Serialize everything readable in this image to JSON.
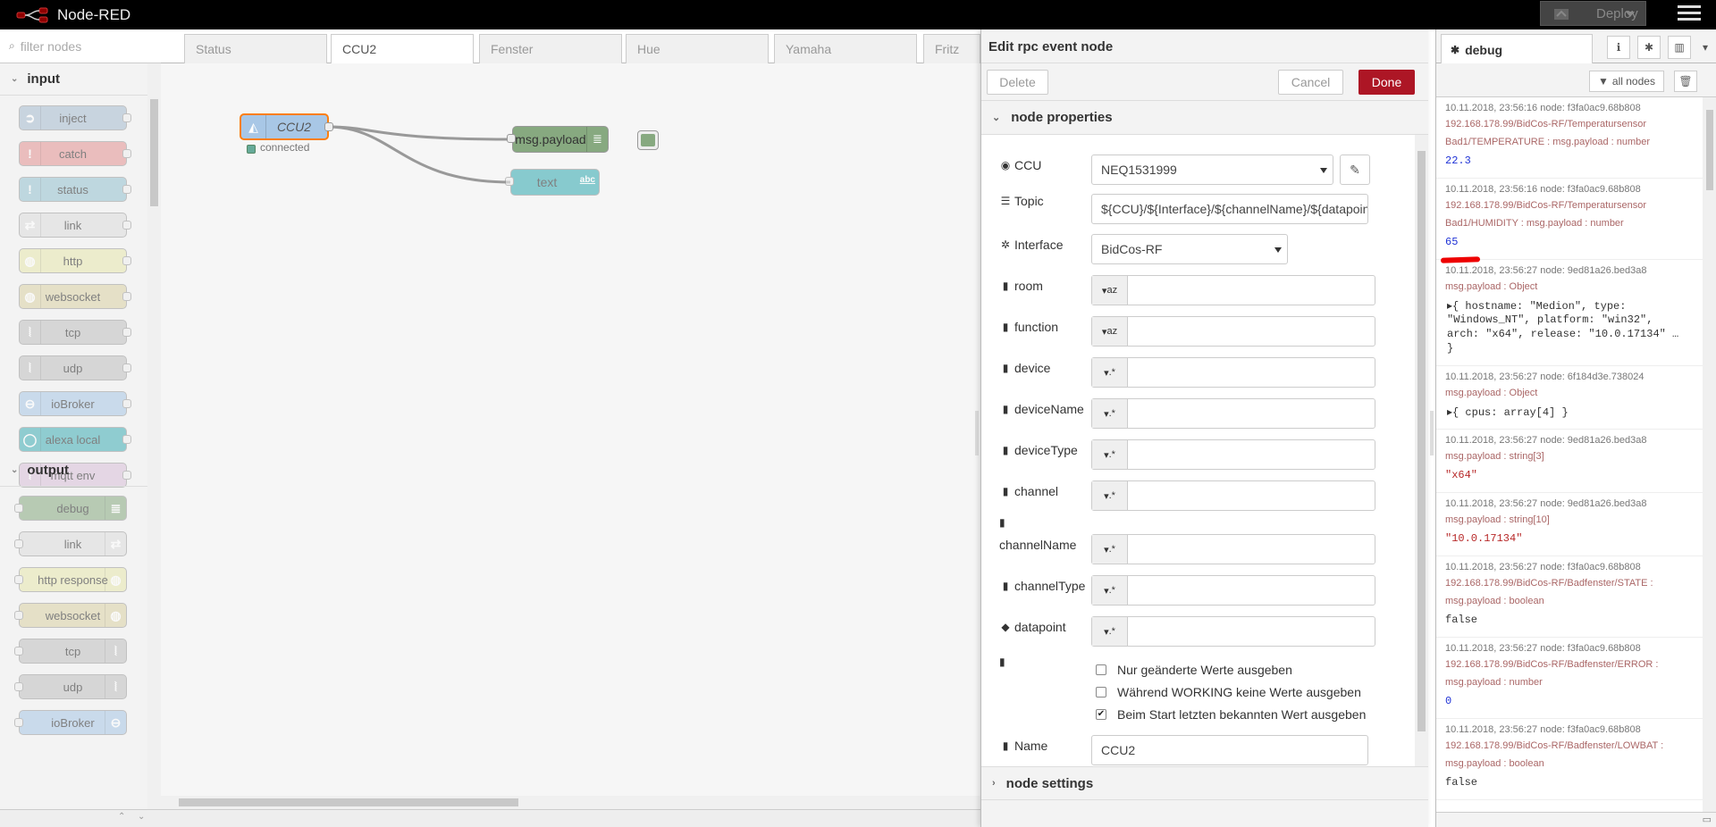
{
  "header": {
    "app_title": "Node-RED",
    "deploy_label": "Deploy"
  },
  "palette": {
    "filter_placeholder": "filter nodes",
    "categories": [
      {
        "label": "input",
        "nodes": [
          {
            "label": "inject",
            "color": "#a6bbcf",
            "icon": "arrow-icon"
          },
          {
            "label": "catch",
            "color": "#e49191",
            "icon": "exclamation-icon"
          },
          {
            "label": "status",
            "color": "#94c1d0",
            "icon": "exclamation-icon"
          },
          {
            "label": "link",
            "color": "#dddddd",
            "icon": "link-icon"
          },
          {
            "label": "http",
            "color": "#e7e7ae",
            "icon": "globe-icon"
          },
          {
            "label": "websocket",
            "color": "#dbd2a4",
            "icon": "globe-icon"
          },
          {
            "label": "tcp",
            "color": "#c0c0c0",
            "icon": "bridge-icon"
          },
          {
            "label": "udp",
            "color": "#c0c0c0",
            "icon": "bridge-icon"
          },
          {
            "label": "ioBroker",
            "color": "#a8c7e6",
            "icon": "iobroker-icon"
          },
          {
            "label": "alexa local",
            "color": "#3fadb5",
            "icon": "alexa-icon"
          },
          {
            "label": "mqtt env",
            "color": "#d8bfd8",
            "icon": "bridge-icon"
          }
        ]
      },
      {
        "label": "output",
        "nodes": [
          {
            "label": "debug",
            "color": "#87a980",
            "icon": "list-icon"
          },
          {
            "label": "link",
            "color": "#dddddd",
            "icon": "link-icon"
          },
          {
            "label": "http response",
            "color": "#e7e7ae",
            "icon": "globe-icon"
          },
          {
            "label": "websocket",
            "color": "#dbd2a4",
            "icon": "globe-icon"
          },
          {
            "label": "tcp",
            "color": "#c0c0c0",
            "icon": "bridge-icon"
          },
          {
            "label": "udp",
            "color": "#c0c0c0",
            "icon": "bridge-icon"
          },
          {
            "label": "ioBroker",
            "color": "#a8c7e6",
            "icon": "iobroker-icon"
          }
        ]
      }
    ]
  },
  "workspace": {
    "tabs": [
      "Status",
      "CCU2",
      "Fenster",
      "Hue",
      "Yamaha",
      "Fritz"
    ],
    "active_tab": "CCU2",
    "nodes": {
      "ccu": {
        "label": "CCU2",
        "status": "connected"
      },
      "debug": {
        "label": "msg.payload"
      },
      "text": {
        "label": "text",
        "badge": "abc"
      }
    }
  },
  "editor": {
    "title": "Edit rpc event node",
    "delete_label": "Delete",
    "cancel_label": "Cancel",
    "done_label": "Done",
    "section_properties": "node properties",
    "section_settings": "node settings",
    "fields": {
      "ccu": {
        "label": "CCU",
        "value": "NEQ1531999"
      },
      "topic": {
        "label": "Topic",
        "value": "${CCU}/${Interface}/${channelName}/${datapoint}"
      },
      "interface": {
        "label": "Interface",
        "value": "BidCos-RF"
      },
      "room": {
        "label": "room",
        "type_icon": "az"
      },
      "function": {
        "label": "function",
        "type_icon": "az"
      },
      "device": {
        "label": "device",
        "type_icon": ".*"
      },
      "deviceName": {
        "label": "deviceName",
        "type_icon": ".*"
      },
      "deviceType": {
        "label": "deviceType",
        "type_icon": ".*"
      },
      "channel": {
        "label": "channel",
        "type_icon": ".*"
      },
      "channelName": {
        "label": "channelName",
        "type_icon": ".*"
      },
      "channelType": {
        "label": "channelType",
        "type_icon": ".*"
      },
      "datapoint": {
        "label": "datapoint",
        "type_icon": ".*"
      },
      "name": {
        "label": "Name",
        "value": "CCU2"
      }
    },
    "checkboxes": [
      {
        "label": "Nur geänderte Werte ausgeben",
        "checked": false
      },
      {
        "label": "Während WORKING keine Werte ausgeben",
        "checked": false
      },
      {
        "label": "Beim Start letzten bekannten Wert ausgeben",
        "checked": true
      }
    ]
  },
  "sidebar": {
    "tab_label": "debug",
    "filter_label": "all nodes",
    "messages": [
      {
        "meta": "10.11.2018, 23:56:16   node: f3fa0ac9.68b808",
        "topic": [
          "192.168.178.99/BidCos-RF/Temperatursensor",
          "Bad1/TEMPERATURE : msg.payload : number"
        ],
        "value": "22.3",
        "kind": "num"
      },
      {
        "meta": "10.11.2018, 23:56:16   node: f3fa0ac9.68b808",
        "topic": [
          "192.168.178.99/BidCos-RF/Temperatursensor",
          "Bad1/HUMIDITY : msg.payload : number"
        ],
        "value": "65",
        "kind": "num"
      },
      {
        "meta": "10.11.2018, 23:56:27   node: 9ed81a26.bed3a8",
        "topic": [
          "msg.payload : Object"
        ],
        "value": [
          "▸{ hostname: \"Medion\", type:",
          "\"Windows_NT\", platform: \"win32\",",
          "arch: \"x64\", release: \"10.0.17134\" …",
          "}"
        ],
        "kind": "obj"
      },
      {
        "meta": "10.11.2018, 23:56:27   node: 6f184d3e.738024",
        "topic": [
          "msg.payload : Object"
        ],
        "value": [
          "▸{ cpus: array[4] }"
        ],
        "kind": "obj"
      },
      {
        "meta": "10.11.2018, 23:56:27   node: 9ed81a26.bed3a8",
        "topic": [
          "msg.payload : string[3]"
        ],
        "value": "\"x64\"",
        "kind": "str"
      },
      {
        "meta": "10.11.2018, 23:56:27   node: 9ed81a26.bed3a8",
        "topic": [
          "msg.payload : string[10]"
        ],
        "value": "\"10.0.17134\"",
        "kind": "str"
      },
      {
        "meta": "10.11.2018, 23:56:27   node: f3fa0ac9.68b808",
        "topic": [
          "192.168.178.99/BidCos-RF/Badfenster/STATE :",
          "msg.payload : boolean"
        ],
        "value": "false",
        "kind": "bool"
      },
      {
        "meta": "10.11.2018, 23:56:27   node: f3fa0ac9.68b808",
        "topic": [
          "192.168.178.99/BidCos-RF/Badfenster/ERROR :",
          "msg.payload : number"
        ],
        "value": "0",
        "kind": "num"
      },
      {
        "meta": "10.11.2018, 23:56:27   node: f3fa0ac9.68b808",
        "topic": [
          "192.168.178.99/BidCos-RF/Badfenster/LOWBAT :",
          "msg.payload : boolean"
        ],
        "value": "false",
        "kind": "bool"
      }
    ]
  }
}
